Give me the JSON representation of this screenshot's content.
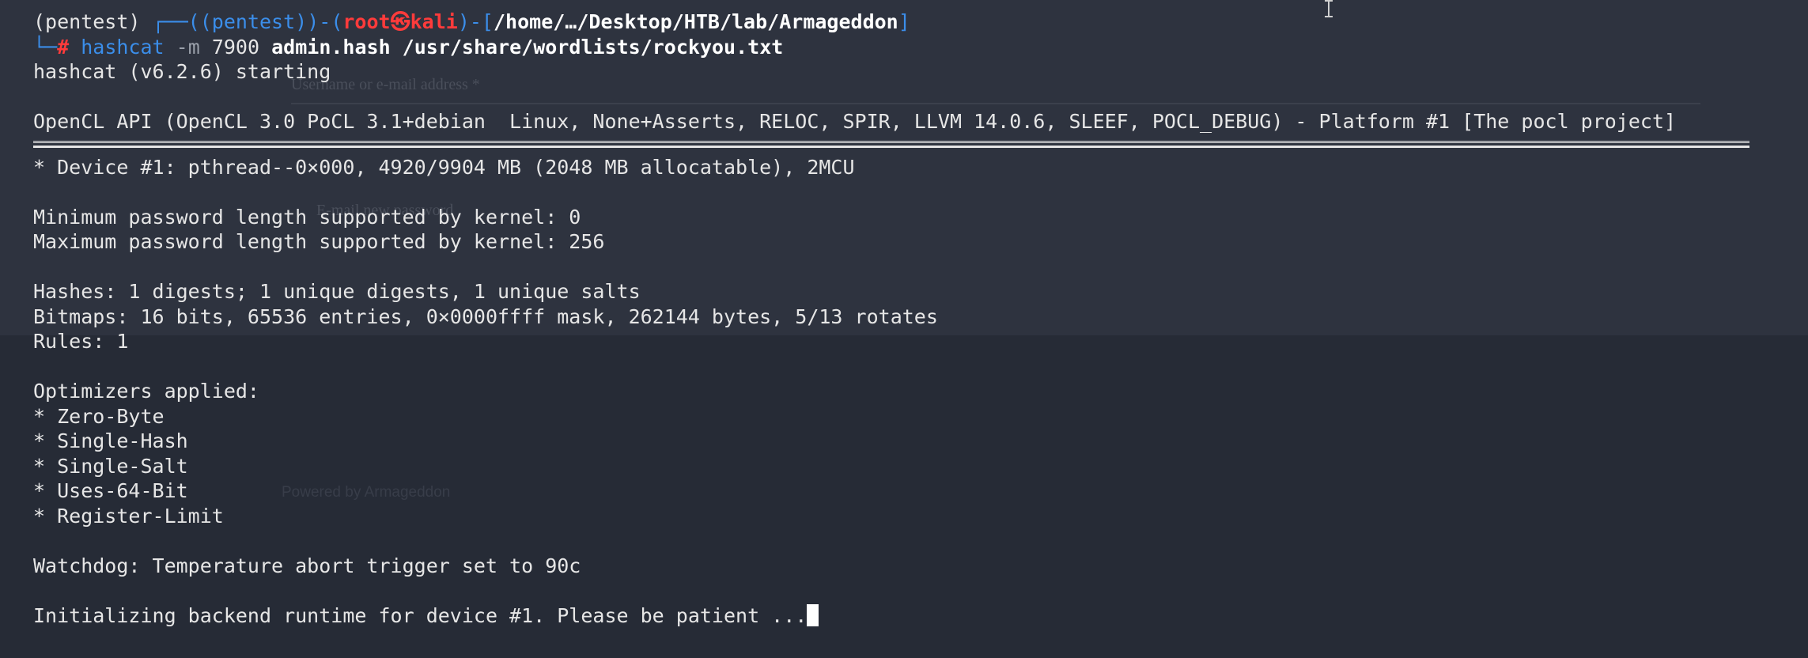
{
  "background_ghost": {
    "username_label": "Username or e-mail address *",
    "email_password": "E-mail new password",
    "powered_by": "Powered by Armageddon"
  },
  "prompt": {
    "venv": "(pentest)",
    "venv_inner": "(pentest)",
    "user": "root",
    "at_symbol": "㉿",
    "host": "kali",
    "path": "/home/…/Desktop/HTB/lab/Armageddon",
    "hash_sign": "#",
    "command": "hashcat",
    "flag": "-m",
    "mode": "7900",
    "args": "admin.hash /usr/share/wordlists/rockyou.txt"
  },
  "output": {
    "starting": "hashcat (v6.2.6) starting",
    "opencl": "OpenCL API (OpenCL 3.0 PoCL 3.1+debian  Linux, None+Asserts, RELOC, SPIR, LLVM 14.0.6, SLEEF, POCL_DEBUG) - Platform #1 [The pocl project]",
    "device": "* Device #1: pthread--0×000, 4920/9904 MB (2048 MB allocatable), 2MCU",
    "min_pw": "Minimum password length supported by kernel: 0",
    "max_pw": "Maximum password length supported by kernel: 256",
    "hashes": "Hashes: 1 digests; 1 unique digests, 1 unique salts",
    "bitmaps": "Bitmaps: 16 bits, 65536 entries, 0×0000ffff mask, 262144 bytes, 5/13 rotates",
    "rules": "Rules: 1",
    "optimizers_header": "Optimizers applied:",
    "optimizers": [
      "* Zero-Byte",
      "* Single-Hash",
      "* Single-Salt",
      "* Uses-64-Bit",
      "* Register-Limit"
    ],
    "watchdog": "Watchdog: Temperature abort trigger set to 90c",
    "initializing": "Initializing backend runtime for device #1. Please be patient ..."
  },
  "colors": {
    "background": "#262b36",
    "prompt_blue": "#3b8eea",
    "prompt_red": "#ff3b3b",
    "text": "#e6e6e6"
  }
}
